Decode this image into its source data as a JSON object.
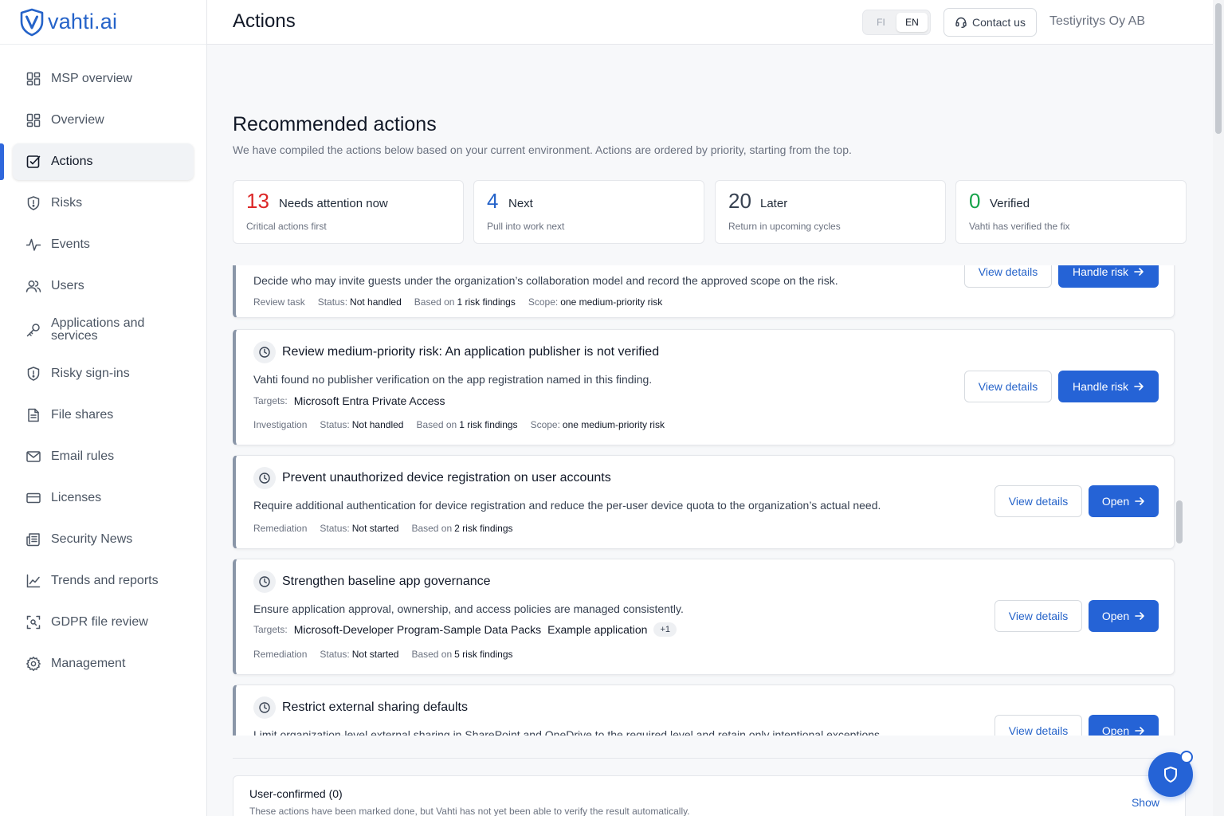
{
  "app": {
    "logo_text": "vahti.ai",
    "page_title": "Actions",
    "languages": [
      "FI",
      "EN"
    ],
    "active_language": "EN",
    "contact_label": "Contact us",
    "org_name": "Testiyritys Oy AB"
  },
  "sidebar": {
    "items": [
      {
        "label": "MSP overview",
        "icon": "grid-icon"
      },
      {
        "label": "Overview",
        "icon": "grid-icon"
      },
      {
        "label": "Actions",
        "icon": "checkbox-icon",
        "active": true
      },
      {
        "label": "Risks",
        "icon": "shield-alert-icon"
      },
      {
        "label": "Events",
        "icon": "activity-icon"
      },
      {
        "label": "Users",
        "icon": "users-icon"
      },
      {
        "label": "Applications and services",
        "icon": "key-icon"
      },
      {
        "label": "Risky sign-ins",
        "icon": "shield-alert-icon"
      },
      {
        "label": "File shares",
        "icon": "file-icon"
      },
      {
        "label": "Email rules",
        "icon": "mail-icon"
      },
      {
        "label": "Licenses",
        "icon": "card-icon"
      },
      {
        "label": "Security News",
        "icon": "newspaper-icon"
      },
      {
        "label": "Trends and reports",
        "icon": "chart-icon"
      },
      {
        "label": "GDPR file review",
        "icon": "scan-icon"
      },
      {
        "label": "Management",
        "icon": "gear-icon"
      }
    ]
  },
  "recommended": {
    "title": "Recommended actions",
    "description": "We have compiled the actions below based on your current environment. Actions are ordered by priority, starting from the top."
  },
  "stats": [
    {
      "value": "13",
      "label": "Needs attention now",
      "sub": "Critical actions first",
      "color": "#dc2626"
    },
    {
      "value": "4",
      "label": "Next",
      "sub": "Pull into work next",
      "color": "#2563c9"
    },
    {
      "value": "20",
      "label": "Later",
      "sub": "Return in upcoming cycles",
      "color": "#374151"
    },
    {
      "value": "0",
      "label": "Verified",
      "sub": "Vahti has verified the fix",
      "color": "#16a34a"
    }
  ],
  "labels": {
    "status": "Status:",
    "based_on": "Based on",
    "scope": "Scope:",
    "targets": "Targets:",
    "view_details": "View details",
    "handle_risk": "Handle risk",
    "open": "Open"
  },
  "actions": [
    {
      "description": "Decide who may invite guests under the organization’s collaboration model and record the approved scope on the risk.",
      "type": "Review task",
      "status": "Not handled",
      "findings": "1 risk findings",
      "scope": "one medium-priority risk",
      "primary": "Handle risk"
    },
    {
      "title": "Review medium-priority risk: An application publisher is not verified",
      "description": "Vahti found no publisher verification on the app registration named in this finding.",
      "targets": [
        "Microsoft Entra Private Access"
      ],
      "type": "Investigation",
      "status": "Not handled",
      "findings": "1 risk findings",
      "scope": "one medium-priority risk",
      "primary": "Handle risk"
    },
    {
      "title": "Prevent unauthorized device registration on user accounts",
      "description": "Require additional authentication for device registration and reduce the per-user device quota to the organization’s actual need.",
      "type": "Remediation",
      "status": "Not started",
      "findings": "2 risk findings",
      "primary": "Open"
    },
    {
      "title": "Strengthen baseline app governance",
      "description": "Ensure application approval, ownership, and access policies are managed consistently.",
      "targets": [
        "Microsoft-Developer Program-Sample Data Packs",
        "Example application"
      ],
      "targets_more": "+1",
      "type": "Remediation",
      "status": "Not started",
      "findings": "5 risk findings",
      "primary": "Open"
    },
    {
      "title": "Restrict external sharing defaults",
      "description": "Limit organization-level external sharing in SharePoint and OneDrive to the required level and retain only intentional exceptions.",
      "primary": "Open"
    }
  ],
  "confirmed": {
    "title": "User-confirmed (0)",
    "description": "These actions have been marked done, but Vahti has not yet been able to verify the result automatically.",
    "show_label": "Show"
  }
}
